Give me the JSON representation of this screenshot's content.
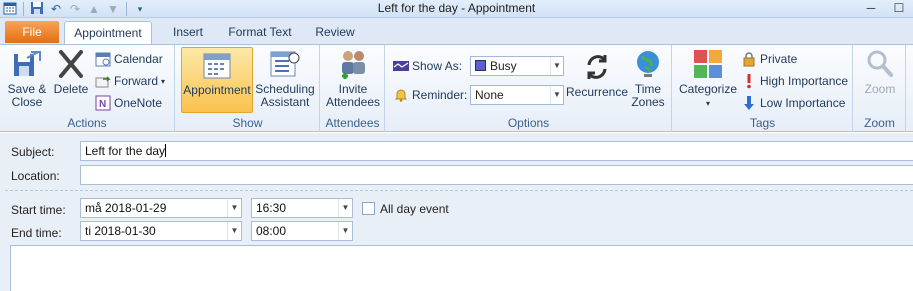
{
  "window": {
    "title": "Left for the day  -  Appointment",
    "minimize": "─",
    "maximize": "☐"
  },
  "qat": {
    "calendar_icon": "calendar-icon",
    "save_icon": "save-icon",
    "undo_icon": "undo-icon",
    "redo_icon": "redo-icon",
    "up_icon": "up-arrow-icon",
    "down_icon": "down-arrow-icon",
    "customize_icon": "customize-icon"
  },
  "tabs": {
    "file": "File",
    "items": [
      "Appointment",
      "Insert",
      "Format Text",
      "Review"
    ]
  },
  "ribbon": {
    "actions": {
      "save_close": [
        "Save &",
        "Close"
      ],
      "delete": "Delete",
      "calendar": "Calendar",
      "forward": "Forward",
      "onenote": "OneNote",
      "label": "Actions"
    },
    "show": {
      "appointment": "Appointment",
      "scheduling": [
        "Scheduling",
        "Assistant"
      ],
      "label": "Show"
    },
    "attendees": {
      "invite": [
        "Invite",
        "Attendees"
      ],
      "label": "Attendees"
    },
    "options": {
      "show_as_label": "Show As:",
      "show_as_value": "Busy",
      "reminder_label": "Reminder:",
      "reminder_value": "None",
      "recurrence": "Recurrence",
      "time_zones": [
        "Time",
        "Zones"
      ],
      "label": "Options"
    },
    "tags": {
      "categorize": "Categorize",
      "private": "Private",
      "high": "High Importance",
      "low": "Low Importance",
      "label": "Tags"
    },
    "zoom": {
      "zoom_btn": "Zoom",
      "label": "Zoom"
    }
  },
  "form": {
    "subject_label": "Subject:",
    "subject_value": "Left for the day",
    "location_label": "Location:",
    "location_value": "",
    "start_label": "Start time:",
    "start_date": "må 2018-01-29",
    "start_time": "16:30",
    "all_day_label": "All day event",
    "all_day_checked": false,
    "end_label": "End time:",
    "end_date": "ti 2018-01-30",
    "end_time": "08:00"
  },
  "colors": {
    "file_tab": "#e36f10",
    "busy": "#5b5fd6",
    "selected": "#f9c24d"
  }
}
